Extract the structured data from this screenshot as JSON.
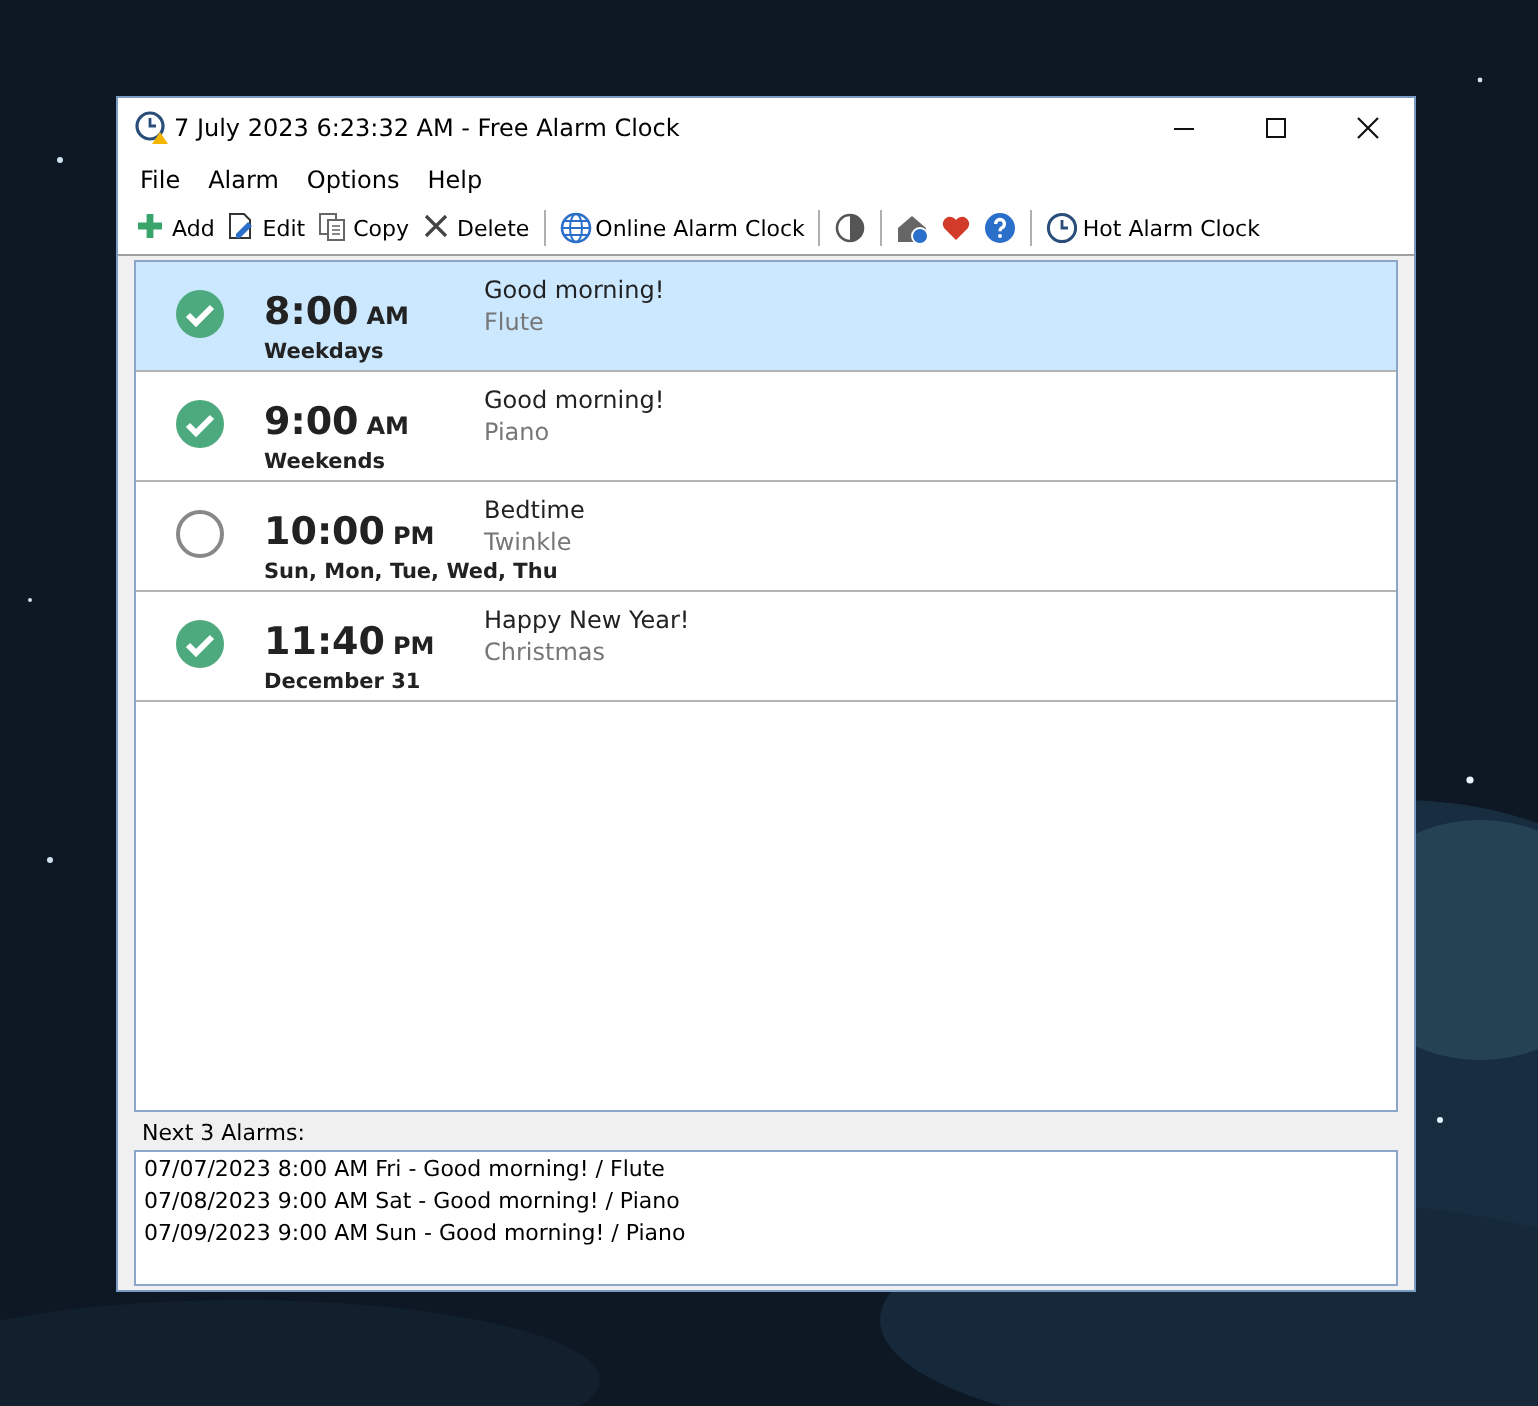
{
  "window": {
    "title": "7 July 2023 6:23:32 AM - Free Alarm Clock"
  },
  "menu": [
    "File",
    "Alarm",
    "Options",
    "Help"
  ],
  "toolbar": [
    {
      "label": "Add"
    },
    {
      "label": "Edit"
    },
    {
      "label": "Copy"
    },
    {
      "label": "Delete"
    },
    {
      "label": "Online Alarm Clock"
    },
    {
      "label": "Hot Alarm Clock"
    }
  ],
  "alarms": [
    {
      "time": "8:00",
      "period": "AM",
      "repeat": "Weekdays",
      "title": "Good morning!",
      "sound": "Flute",
      "enabled": true,
      "selected": true
    },
    {
      "time": "9:00",
      "period": "AM",
      "repeat": "Weekends",
      "title": "Good morning!",
      "sound": "Piano",
      "enabled": true,
      "selected": false
    },
    {
      "time": "10:00",
      "period": "PM",
      "repeat": "Sun, Mon, Tue, Wed, Thu",
      "title": "Bedtime",
      "sound": "Twinkle",
      "enabled": false,
      "selected": false
    },
    {
      "time": "11:40",
      "period": "PM",
      "repeat": "December 31",
      "title": "Happy New Year!",
      "sound": "Christmas",
      "enabled": true,
      "selected": false
    }
  ],
  "next_alarms": {
    "label": "Next 3 Alarms:",
    "items": [
      "07/07/2023 8:00 AM Fri - Good morning! / Flute",
      "07/08/2023 9:00 AM Sat - Good morning! / Piano",
      "07/09/2023 9:00 AM Sun - Good morning! / Piano"
    ]
  }
}
